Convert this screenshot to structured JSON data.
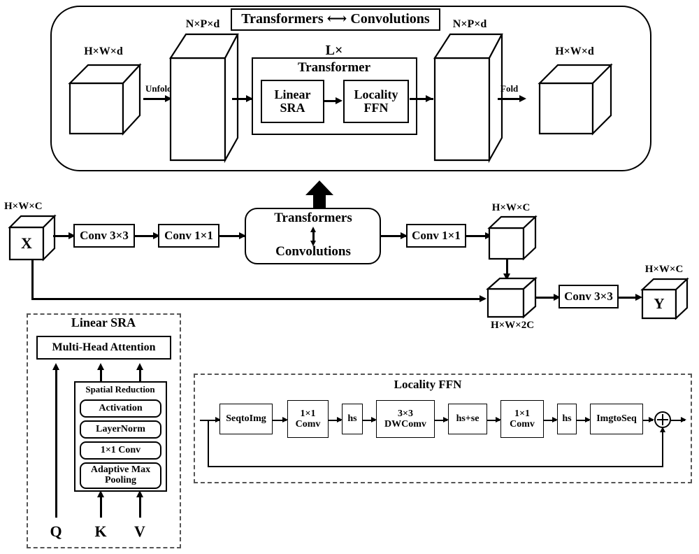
{
  "diagram": {
    "title_banner": "Transformers ⟷ Convolutions",
    "top_panel": {
      "name": "transformers-convolutions-detail",
      "input_cube_label": "H×W×d",
      "unfold_label": "Unfold",
      "unfolded_cube_label": "N×P×d",
      "repeat_label": "L×",
      "transformer_label": "Transformer",
      "linear_sra_label": "Linear\nSRA",
      "linear_sra_line1": "Linear",
      "linear_sra_line2": "SRA",
      "locality_ffn_line1": "Locality",
      "locality_ffn_line2": "FFN",
      "output_cube_label": "N×P×d",
      "fold_label": "Fold",
      "folded_cube_label": "H×W×d"
    },
    "main_pipeline": {
      "name": "main-pipeline",
      "input_cube_dim": "H×W×C",
      "input_cube_symbol": "X",
      "conv3x3_first": "Conv 3×3",
      "conv1x1_first": "Conv 1×1",
      "module_top": "Transformers",
      "module_bottom": "Convolutions",
      "conv1x1_second": "Conv 1×1",
      "mid_cube_dim": "H×W×C",
      "concat_cube_dim": "H×W×2C",
      "conv3x3_second": "Conv 3×3",
      "output_cube_dim": "H×W×C",
      "output_cube_symbol": "Y"
    },
    "linear_sra_panel": {
      "name": "linear-sra-panel",
      "title": "Linear SRA",
      "attention_label": "Multi-Head Attention",
      "spatial_reduction_title": "Spatial Reduction",
      "stack": [
        "Activation",
        "LayerNorm",
        "1×1 Conv",
        "Adaptive Max\nPooling"
      ],
      "stack_items": [
        {
          "line1": "Activation",
          "line2": ""
        },
        {
          "line1": "LayerNorm",
          "line2": ""
        },
        {
          "line1": "1×1 Conv",
          "line2": ""
        },
        {
          "line1": "Adaptive Max",
          "line2": "Pooling"
        }
      ],
      "inputs": [
        {
          "label": "Q"
        },
        {
          "label": "K"
        },
        {
          "label": "V"
        }
      ]
    },
    "locality_ffn_panel": {
      "name": "locality-ffn-panel",
      "title": "Locality FFN",
      "blocks": [
        {
          "line1": "SeqtoImg",
          "line2": ""
        },
        {
          "line1": "1×1",
          "line2": "Comv"
        },
        {
          "line1": "hs",
          "line2": ""
        },
        {
          "line1": "3×3",
          "line2": "DWComv"
        },
        {
          "line1": "hs+se",
          "line2": ""
        },
        {
          "line1": "1×1",
          "line2": "Comv"
        },
        {
          "line1": "hs",
          "line2": ""
        },
        {
          "line1": "ImgtoSeq",
          "line2": ""
        }
      ],
      "residual_add_icon": "circle-plus-icon"
    },
    "colors": {
      "stroke": "#000000",
      "background": "#ffffff",
      "dashed_border": "#555555"
    }
  }
}
